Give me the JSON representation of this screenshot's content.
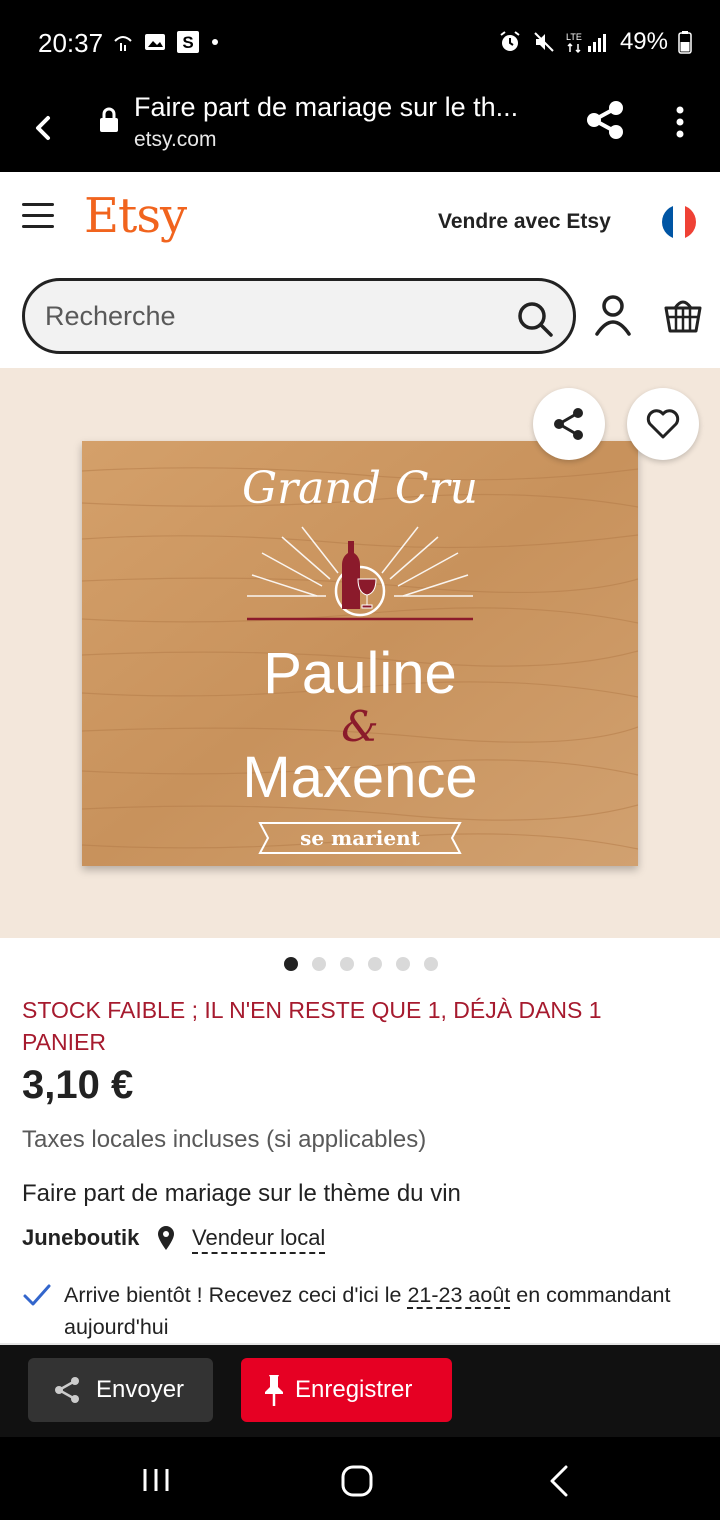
{
  "status_bar": {
    "time": "20:37",
    "battery": "49%",
    "network": "LTE"
  },
  "browser": {
    "page_title": "Faire part de mariage sur le th...",
    "url": "etsy.com"
  },
  "header": {
    "logo": "Etsy",
    "sell_link": "Vendre avec Etsy",
    "flag_colors": [
      "#0055A4",
      "#FFFFFF",
      "#EF4135"
    ]
  },
  "search": {
    "placeholder": "Recherche"
  },
  "product_image": {
    "line1": "Grand Cru",
    "line2": "Pauline",
    "line3": "&",
    "line4": "Maxence",
    "ribbon": "se marient",
    "total_images": 6,
    "current_image": 1
  },
  "product": {
    "stock_notice": "STOCK FAIBLE ; IL N'EN RESTE QUE 1, DÉJÀ DANS 1 PANIER",
    "price": "3,10 €",
    "taxes": "Taxes locales incluses (si applicables)",
    "title": "Faire part de mariage sur le thème du vin",
    "shop_name": "Juneboutik",
    "local_label": "Vendeur local",
    "delivery_prefix": "Arrive bientôt ! Recevez ceci d'ici le ",
    "delivery_dates": "21-23 août",
    "delivery_suffix": " en commandant aujourd'hui"
  },
  "share_bar": {
    "send_label": "Envoyer",
    "save_label": "Enregistrer"
  },
  "colors": {
    "etsy_orange": "#F1641E",
    "stock_red": "#A61A2E",
    "pinterest_red": "#E60023",
    "wine_red": "#8B1A2B"
  }
}
